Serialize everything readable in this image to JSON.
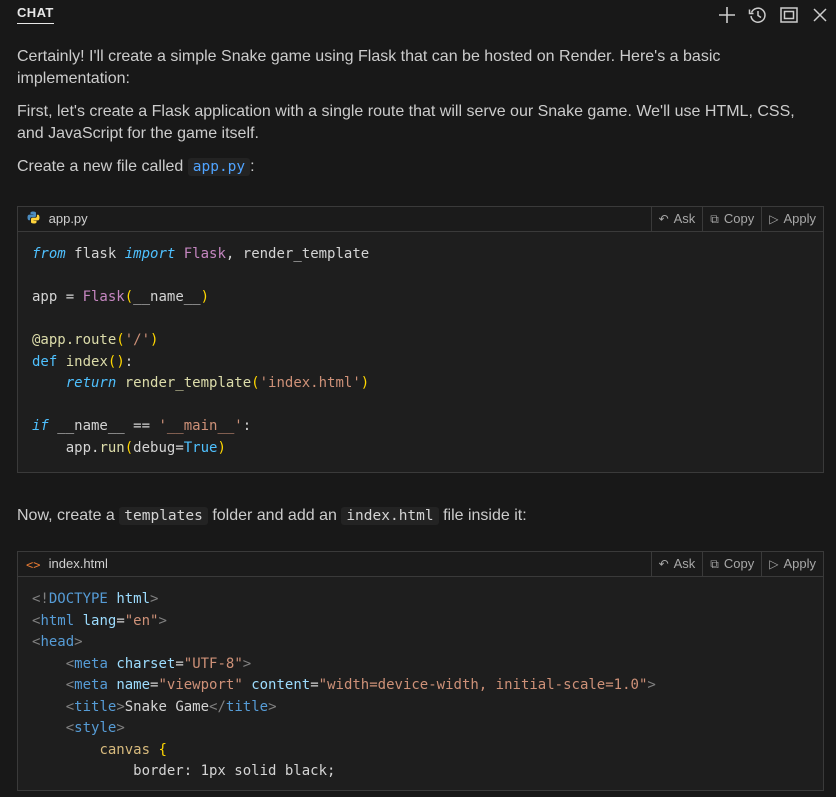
{
  "header": {
    "title": "CHAT",
    "icons": [
      "plus-icon",
      "history-icon",
      "maximize-icon",
      "close-icon"
    ]
  },
  "messages": {
    "p1": "Certainly! I'll create a simple Snake game using Flask that can be hosted on Render. Here's a basic implementation:",
    "p2": "First, let's create a Flask application with a single route that will serve our Snake game. We'll use HTML, CSS, and JavaScript for the game itself.",
    "p3_pre": "Create a new file called",
    "p3_code": "app.py",
    "p3_post": ":",
    "p4_pre": "Now, create a",
    "p4_code1": "templates",
    "p4_mid": "folder and add an",
    "p4_code2": "index.html",
    "p4_post": "file inside it:"
  },
  "codeblocks": [
    {
      "filename": "app.py",
      "file_icon": "python-icon",
      "actions": {
        "ask": "Ask",
        "copy": "Copy",
        "apply": "Apply"
      },
      "lines": [
        "from flask import Flask, render_template",
        "",
        "app = Flask(__name__)",
        "",
        "@app.route('/')",
        "def index():",
        "    return render_template('index.html')",
        "",
        "if __name__ == '__main__':",
        "    app.run(debug=True)"
      ]
    },
    {
      "filename": "index.html",
      "file_icon": "html-icon",
      "actions": {
        "ask": "Ask",
        "copy": "Copy",
        "apply": "Apply"
      },
      "lines": [
        "<!DOCTYPE html>",
        "<html lang=\"en\">",
        "<head>",
        "    <meta charset=\"UTF-8\">",
        "    <meta name=\"viewport\" content=\"width=device-width, initial-scale=1.0\">",
        "    <title>Snake Game</title>",
        "    <style>",
        "        canvas {",
        "            border: 1px solid black;"
      ]
    }
  ]
}
